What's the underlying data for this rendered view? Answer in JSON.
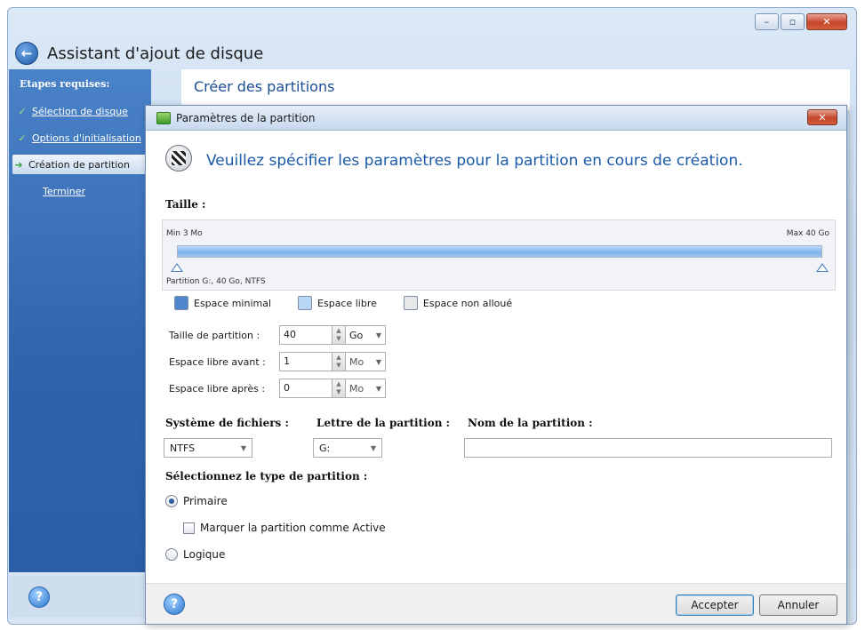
{
  "window": {
    "title": "Assistant d'ajout de disque",
    "controls": {
      "minimize": "–",
      "maximize": "▫",
      "close": "✕"
    },
    "back_glyph": "←"
  },
  "sidebar": {
    "header": "Etapes requises:",
    "items": [
      {
        "label": "Sélection de disque",
        "mark": "✓",
        "state": "done"
      },
      {
        "label": "Options d'initialisation",
        "mark": "✓",
        "state": "done"
      },
      {
        "label": "Création de partition",
        "mark": "➜",
        "state": "active"
      },
      {
        "label": "Terminer",
        "mark": "",
        "state": "pending"
      }
    ],
    "help_glyph": "?"
  },
  "main": {
    "title": "Créer des partitions"
  },
  "dialog": {
    "title": "Paramètres de la partition",
    "close_glyph": "✕",
    "heading": "Veuillez spécifier les paramètres pour la partition en cours de création.",
    "size_label": "Taille :",
    "slider": {
      "min_label": "Min 3 Mo",
      "max_label": "Max 40 Go",
      "partition_caption": "Partition G:, 40 Go, NTFS",
      "fill_fraction": 1.0,
      "min_fraction": 0.0,
      "max_fraction": 1.0
    },
    "legend": [
      {
        "label": "Espace minimal",
        "color": "#4f86cc"
      },
      {
        "label": "Espace libre",
        "color": "#b8d6f5"
      },
      {
        "label": "Espace non alloué",
        "color": "#e8e8e8"
      }
    ],
    "fields": {
      "partition_size": {
        "label": "Taille de partition :",
        "value": "40",
        "unit": "Go"
      },
      "free_before": {
        "label": "Espace libre avant :",
        "value": "1",
        "unit": "Mo"
      },
      "free_after": {
        "label": "Espace libre après :",
        "value": "0",
        "unit": "Mo"
      }
    },
    "filesystem": {
      "label": "Système de fichiers :",
      "value": "NTFS"
    },
    "letter": {
      "label": "Lettre de la partition :",
      "value": "G:"
    },
    "name": {
      "label": "Nom de la partition :",
      "value": ""
    },
    "partition_type": {
      "label": "Sélectionnez le type de partition :",
      "primary": "Primaire",
      "active_checkbox": "Marquer la partition comme Active",
      "logical": "Logique",
      "selected": "primary"
    },
    "buttons": {
      "accept": "Accepter",
      "cancel": "Annuler"
    },
    "help_glyph": "?",
    "spin_up": "▲",
    "spin_down": "▼",
    "caret": "▼"
  }
}
